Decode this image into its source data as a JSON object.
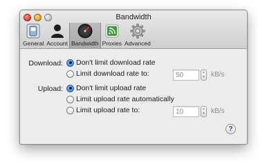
{
  "window": {
    "title": "Bandwidth"
  },
  "toolbar": {
    "items": [
      {
        "label": "General",
        "icon": "switch-icon"
      },
      {
        "label": "Account",
        "icon": "person-icon"
      },
      {
        "label": "Bandwidth",
        "icon": "speedometer-icon",
        "selected": true
      },
      {
        "label": "Proxies",
        "icon": "network-icon"
      },
      {
        "label": "Advanced",
        "icon": "gear-icon"
      }
    ]
  },
  "download": {
    "label": "Download:",
    "no_limit": "Don't limit download rate",
    "limit": "Limit download rate to:",
    "value": "50",
    "unit": "kB/s",
    "selected": "no_limit"
  },
  "upload": {
    "label": "Upload:",
    "no_limit": "Don't limit upload rate",
    "automatic": "Limit upload rate automatically",
    "limit": "Limit upload rate to:",
    "value": "10",
    "unit": "kB/s",
    "selected": "no_limit"
  },
  "help": {
    "label": "?"
  },
  "colors": {
    "accent": "#4a8be3",
    "help_glyph": "#4b2a8a"
  }
}
